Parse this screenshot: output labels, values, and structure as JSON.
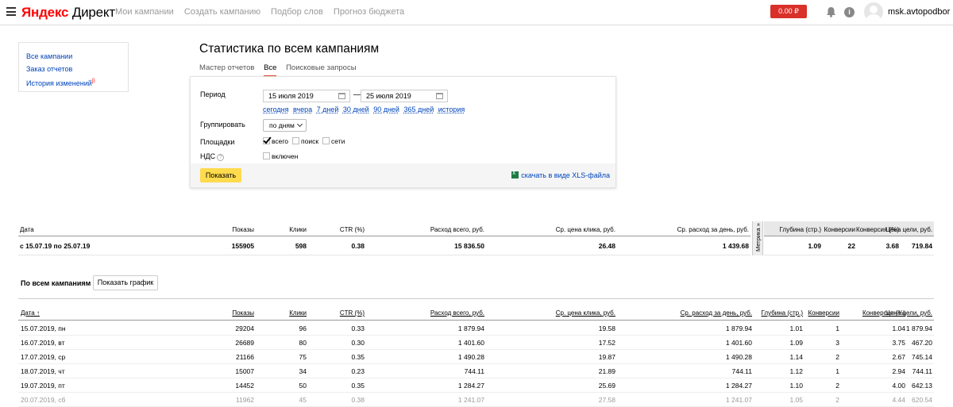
{
  "header": {
    "logo_yandex": "Яндекс",
    "logo_direct": "Директ",
    "nav": [
      "Мои кампании",
      "Создать кампанию",
      "Подбор слов",
      "Прогноз бюджета"
    ],
    "balance": "0.00 ₽",
    "username": "msk.avtopodbor",
    "icons": [
      "menu-icon",
      "bell-icon",
      "info-icon",
      "avatar"
    ]
  },
  "sidebar": {
    "items": [
      "Все кампании",
      "Заказ отчетов",
      "История изменений"
    ],
    "badge": "β"
  },
  "page_title": "Статистика по всем кампаниям",
  "tabs": [
    {
      "label": "Мастер отчетов",
      "active": false
    },
    {
      "label": "Все",
      "active": true
    },
    {
      "label": "Поисковые запросы",
      "active": false
    }
  ],
  "form": {
    "period_label": "Период",
    "date_from": "15 июля 2019",
    "date_to": "25 июля 2019",
    "dash": "—",
    "quick_periods": [
      "сегодня",
      "вчера",
      "7 дней",
      "30 дней",
      "90 дней",
      "365 дней",
      "история"
    ],
    "group_label": "Группировать",
    "group_value": "по дням",
    "platforms_label": "Площадки",
    "platforms": [
      {
        "label": "всего",
        "checked": true
      },
      {
        "label": "поиск",
        "checked": false
      },
      {
        "label": "сети",
        "checked": false
      }
    ],
    "vat_label": "НДС",
    "vat_help": "?",
    "vat_option": "включен",
    "vat_checked": false,
    "show_button": "Показать",
    "xls_link": "скачать в виде XLS-файла"
  },
  "summary": {
    "headers": [
      "Дата",
      "Показы",
      "Клики",
      "CTR (%)",
      "Расход всего, руб.",
      "Ср. цена клика, руб.",
      "Ср. расход за день, руб."
    ],
    "row": [
      "с 15.07.19 по 25.07.19",
      "155905",
      "598",
      "0.38",
      "15 836.50",
      "26.48",
      "1 439.68"
    ],
    "metrika_label": "Метрика »",
    "goal_headers": [
      "Глубина (стр.)",
      "Конверсии",
      "Конверсия (%)",
      "Цена цели, руб."
    ],
    "goal_row": [
      "1.09",
      "22",
      "3.68",
      "719.84"
    ]
  },
  "campaigns": {
    "section_title": "По всем кампаниям",
    "graph_button": "Показать график",
    "headers": [
      "Дата ↑",
      "Показы",
      "Клики",
      "CTR (%)",
      "Расход всего, руб.",
      "Ср. цена клика, руб.",
      "Ср. расход за день, руб.",
      "Глубина (стр.)",
      "Конверсии",
      "Конверсия (%)",
      "Цена цели, руб."
    ],
    "rows": [
      [
        "15.07.2019, пн",
        "29204",
        "96",
        "0.33",
        "1 879.94",
        "19.58",
        "1 879.94",
        "1.01",
        "1",
        "1.04",
        "1 879.94"
      ],
      [
        "16.07.2019, вт",
        "26689",
        "80",
        "0.30",
        "1 401.60",
        "17.52",
        "1 401.60",
        "1.09",
        "3",
        "3.75",
        "467.20"
      ],
      [
        "17.07.2019, ср",
        "21166",
        "75",
        "0.35",
        "1 490.28",
        "19.87",
        "1 490.28",
        "1.14",
        "2",
        "2.67",
        "745.14"
      ],
      [
        "18.07.2019, чт",
        "15007",
        "34",
        "0.23",
        "744.11",
        "21.89",
        "744.11",
        "1.12",
        "1",
        "2.94",
        "744.11"
      ],
      [
        "19.07.2019, пт",
        "14452",
        "50",
        "0.35",
        "1 284.27",
        "25.69",
        "1 284.27",
        "1.10",
        "2",
        "4.00",
        "642.13"
      ],
      [
        "20.07.2019, сб",
        "11962",
        "45",
        "0.38",
        "1 241.07",
        "27.58",
        "1 241.07",
        "1.05",
        "2",
        "4.44",
        "620.54"
      ]
    ]
  },
  "colors": {
    "accent": "#e0452b",
    "link": "#0044bb",
    "button": "#ffdb4d",
    "balance": "#d9302a"
  }
}
